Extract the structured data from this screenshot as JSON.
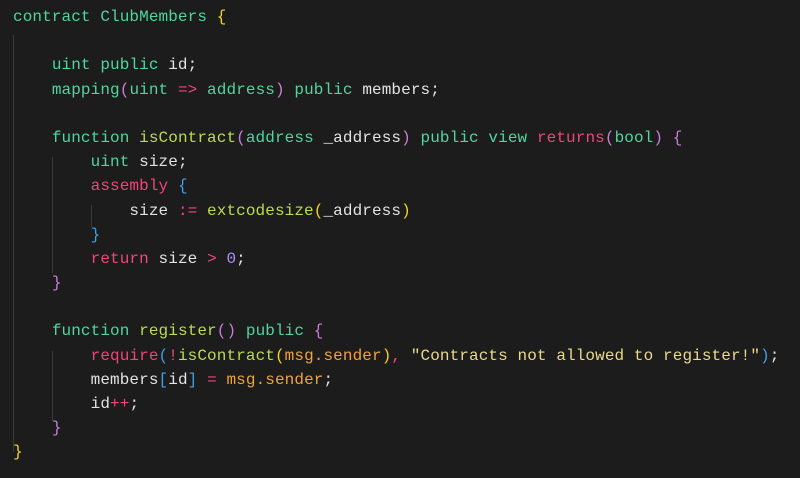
{
  "colors": {
    "background": "#1c1c1c",
    "plain": "#e2e2e2",
    "keyword": "#4fd69c",
    "control": "#f0457a",
    "func": "#b9dc52",
    "brace_yellow": "#f2d31e",
    "brace_purple": "#c77ddb",
    "brace_blue": "#3f9ee8",
    "member": "#f3a23c",
    "string": "#ead98a",
    "number": "#b38cff",
    "operator": "#f0457a"
  },
  "code_lines": [
    [
      [
        "contract ClubMembers ",
        "keyword"
      ],
      [
        "{",
        "brace_yellow"
      ]
    ],
    [],
    [
      [
        "    ",
        "plain"
      ],
      [
        "uint public ",
        "keyword"
      ],
      [
        "id;",
        "plain"
      ]
    ],
    [
      [
        "    ",
        "plain"
      ],
      [
        "mapping",
        "keyword"
      ],
      [
        "(",
        "brace_purple"
      ],
      [
        "uint ",
        "keyword"
      ],
      [
        "=>",
        "operator"
      ],
      [
        " address",
        "keyword"
      ],
      [
        ")",
        "brace_purple"
      ],
      [
        " public ",
        "keyword"
      ],
      [
        "members;",
        "plain"
      ]
    ],
    [],
    [
      [
        "    ",
        "plain"
      ],
      [
        "function ",
        "keyword"
      ],
      [
        "isContract",
        "func"
      ],
      [
        "(",
        "brace_purple"
      ],
      [
        "address ",
        "keyword"
      ],
      [
        "_address",
        "plain"
      ],
      [
        ")",
        "brace_purple"
      ],
      [
        " public view ",
        "keyword"
      ],
      [
        "returns",
        "control"
      ],
      [
        "(",
        "brace_purple"
      ],
      [
        "bool",
        "keyword"
      ],
      [
        ")",
        "brace_purple"
      ],
      [
        " ",
        "plain"
      ],
      [
        "{",
        "brace_purple"
      ]
    ],
    [
      [
        "        ",
        "plain"
      ],
      [
        "uint ",
        "keyword"
      ],
      [
        "size;",
        "plain"
      ]
    ],
    [
      [
        "        ",
        "plain"
      ],
      [
        "assembly ",
        "control"
      ],
      [
        "{",
        "brace_blue"
      ]
    ],
    [
      [
        "            ",
        "plain"
      ],
      [
        "size ",
        "plain"
      ],
      [
        ":=",
        "operator"
      ],
      [
        " ",
        "plain"
      ],
      [
        "extcodesize",
        "func"
      ],
      [
        "(",
        "brace_yellow"
      ],
      [
        "_address",
        "plain"
      ],
      [
        ")",
        "brace_yellow"
      ]
    ],
    [
      [
        "        ",
        "plain"
      ],
      [
        "}",
        "brace_blue"
      ]
    ],
    [
      [
        "        ",
        "plain"
      ],
      [
        "return ",
        "control"
      ],
      [
        "size ",
        "plain"
      ],
      [
        ">",
        "operator"
      ],
      [
        " ",
        "plain"
      ],
      [
        "0",
        "number"
      ],
      [
        ";",
        "plain"
      ]
    ],
    [
      [
        "    ",
        "plain"
      ],
      [
        "}",
        "brace_purple"
      ]
    ],
    [],
    [
      [
        "    ",
        "plain"
      ],
      [
        "function ",
        "keyword"
      ],
      [
        "register",
        "func"
      ],
      [
        "()",
        "brace_purple"
      ],
      [
        " public ",
        "keyword"
      ],
      [
        "{",
        "brace_purple"
      ]
    ],
    [
      [
        "        ",
        "plain"
      ],
      [
        "require",
        "control"
      ],
      [
        "(",
        "brace_blue"
      ],
      [
        "!",
        "operator"
      ],
      [
        "isContract",
        "func"
      ],
      [
        "(",
        "brace_yellow"
      ],
      [
        "msg.sender",
        "member"
      ],
      [
        ")",
        "brace_yellow"
      ],
      [
        ",",
        "operator"
      ],
      [
        " ",
        "plain"
      ],
      [
        "\"Contracts not allowed to register!\"",
        "string"
      ],
      [
        ")",
        "brace_blue"
      ],
      [
        ";",
        "plain"
      ]
    ],
    [
      [
        "        ",
        "plain"
      ],
      [
        "members",
        "plain"
      ],
      [
        "[",
        "brace_blue"
      ],
      [
        "id",
        "plain"
      ],
      [
        "]",
        "brace_blue"
      ],
      [
        " ",
        "plain"
      ],
      [
        "=",
        "operator"
      ],
      [
        " ",
        "plain"
      ],
      [
        "msg.sender",
        "member"
      ],
      [
        ";",
        "plain"
      ]
    ],
    [
      [
        "        ",
        "plain"
      ],
      [
        "id",
        "plain"
      ],
      [
        "++",
        "operator"
      ],
      [
        ";",
        "plain"
      ]
    ],
    [
      [
        "    ",
        "plain"
      ],
      [
        "}",
        "brace_purple"
      ]
    ],
    [
      [
        "}",
        "brace_yellow"
      ]
    ]
  ]
}
